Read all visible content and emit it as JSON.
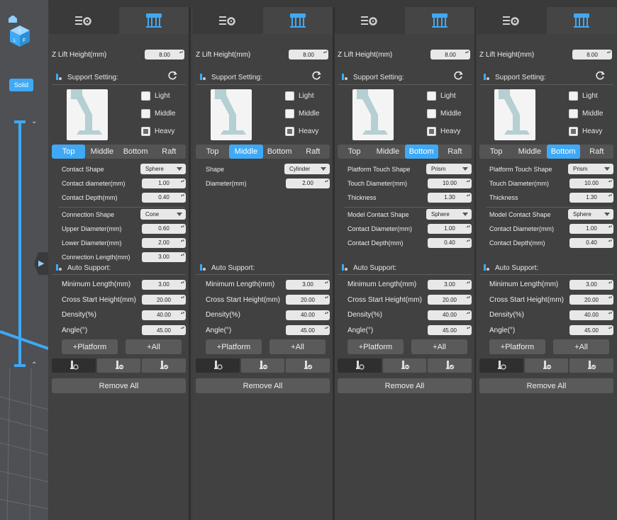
{
  "sidebar": {
    "solid_label": "Solid"
  },
  "colors": {
    "accent": "#3fa9f5",
    "panel_bg": "#414141"
  },
  "panels": [
    {
      "tab_icons": [
        "settings-list-icon",
        "support-pillars-icon"
      ],
      "z_lift_label": "Z Lift Height(mm)",
      "z_lift_value": "8.00",
      "support_setting_title": "Support Setting:",
      "density_options": [
        "Light",
        "Middle",
        "Heavy"
      ],
      "density_checked": "Heavy",
      "part_tabs": [
        "Top",
        "Middle",
        "Bottom",
        "Raft"
      ],
      "active_part": "Top",
      "fields": [
        {
          "label": "Contact Shape",
          "type": "dropdown",
          "value": "Sphere"
        },
        {
          "label": "Contact diameter(mm)",
          "type": "spin",
          "value": "1.00"
        },
        {
          "label": "Contact Depth(mm)",
          "type": "spin",
          "value": "0.40"
        },
        {
          "label": "Connection Shape",
          "type": "dropdown",
          "value": "Cone"
        },
        {
          "label": "Upper Diameter(mm)",
          "type": "spin",
          "value": "0.60"
        },
        {
          "label": "Lower Diameter(mm)",
          "type": "spin",
          "value": "2.00"
        },
        {
          "label": "Connection Length(mm)",
          "type": "spin",
          "value": "3.00"
        }
      ],
      "auto_support_title": "Auto Support:",
      "auto_fields": [
        {
          "label": "Minimum Length(mm)",
          "value": "3.00"
        },
        {
          "label": "Cross Start Height(mm)",
          "value": "20.00"
        },
        {
          "label": "Density(%)",
          "value": "40.00"
        },
        {
          "label": "Angle(°)",
          "value": "45.00"
        }
      ],
      "platform_label": "+Platform",
      "all_label": "+All",
      "remove_all_label": "Remove All"
    },
    {
      "tab_icons": [
        "settings-list-icon",
        "support-pillars-icon"
      ],
      "z_lift_label": "Z Lift Height(mm)",
      "z_lift_value": "8.00",
      "support_setting_title": "Support Setting:",
      "density_options": [
        "Light",
        "Middle",
        "Heavy"
      ],
      "density_checked": "Heavy",
      "part_tabs": [
        "Top",
        "Middle",
        "Bottom",
        "Raft"
      ],
      "active_part": "Middle",
      "fields": [
        {
          "label": "Shape",
          "type": "dropdown",
          "value": "Cylinder"
        },
        {
          "label": "Diameter(mm)",
          "type": "spin",
          "value": "2.00"
        }
      ],
      "auto_support_title": "Auto Support:",
      "auto_fields": [
        {
          "label": "Minimum Length(mm)",
          "value": "3.00"
        },
        {
          "label": "Cross Start Height(mm)",
          "value": "20.00"
        },
        {
          "label": "Density(%)",
          "value": "40.00"
        },
        {
          "label": "Angle(°)",
          "value": "45.00"
        }
      ],
      "platform_label": "+Platform",
      "all_label": "+All",
      "remove_all_label": "Remove All"
    },
    {
      "tab_icons": [
        "settings-list-icon",
        "support-pillars-icon"
      ],
      "z_lift_label": "Z Lift Height(mm)",
      "z_lift_value": "8.00",
      "support_setting_title": "Support Setting:",
      "density_options": [
        "Light",
        "Middle",
        "Heavy"
      ],
      "density_checked": "Heavy",
      "part_tabs": [
        "Top",
        "Middle",
        "Bottom",
        "Raft"
      ],
      "active_part": "Bottom",
      "fields": [
        {
          "label": "Platform Touch Shape",
          "type": "dropdown",
          "value": "Prism"
        },
        {
          "label": "Touch Diameter(mm)",
          "type": "spin",
          "value": "10.00"
        },
        {
          "label": "Thickness",
          "type": "spin",
          "value": "1.30"
        },
        {
          "label": "Model Contact Shape",
          "type": "dropdown",
          "value": "Sphere"
        },
        {
          "label": "Contact Diameter(mm)",
          "type": "spin",
          "value": "1.00"
        },
        {
          "label": "Contact Depth(mm)",
          "type": "spin",
          "value": "0.40"
        }
      ],
      "auto_support_title": "Auto Support:",
      "auto_fields": [
        {
          "label": "Minimum Length(mm)",
          "value": "3.00"
        },
        {
          "label": "Cross Start Height(mm)",
          "value": "20.00"
        },
        {
          "label": "Density(%)",
          "value": "40.00"
        },
        {
          "label": "Angle(°)",
          "value": "45.00"
        }
      ],
      "platform_label": "+Platform",
      "all_label": "+All",
      "remove_all_label": "Remove All"
    },
    {
      "tab_icons": [
        "settings-list-icon",
        "support-pillars-icon"
      ],
      "z_lift_label": "Z Lift Height(mm)",
      "z_lift_value": "8.00",
      "support_setting_title": "Support Setting:",
      "density_options": [
        "Light",
        "Middle",
        "Heavy"
      ],
      "density_checked": "Heavy",
      "part_tabs": [
        "Top",
        "Middle",
        "Bottom",
        "Raft"
      ],
      "active_part": "Bottom",
      "fields": [
        {
          "label": "Platform Touch Shape",
          "type": "dropdown",
          "value": "Prism"
        },
        {
          "label": "Touch Diameter(mm)",
          "type": "spin",
          "value": "10.00"
        },
        {
          "label": "Thickness",
          "type": "spin",
          "value": "1.30"
        },
        {
          "label": "Model Contact Shape",
          "type": "dropdown",
          "value": "Sphere"
        },
        {
          "label": "Contact Diameter(mm)",
          "type": "spin",
          "value": "1.00"
        },
        {
          "label": "Contact Depth(mm)",
          "type": "spin",
          "value": "0.40"
        }
      ],
      "auto_support_title": "Auto Support:",
      "auto_fields": [
        {
          "label": "Minimum Length(mm)",
          "value": "3.00"
        },
        {
          "label": "Cross Start Height(mm)",
          "value": "20.00"
        },
        {
          "label": "Density(%)",
          "value": "40.00"
        },
        {
          "label": "Angle(°)",
          "value": "45.00"
        }
      ],
      "platform_label": "+Platform",
      "all_label": "+All",
      "remove_all_label": "Remove All"
    }
  ]
}
